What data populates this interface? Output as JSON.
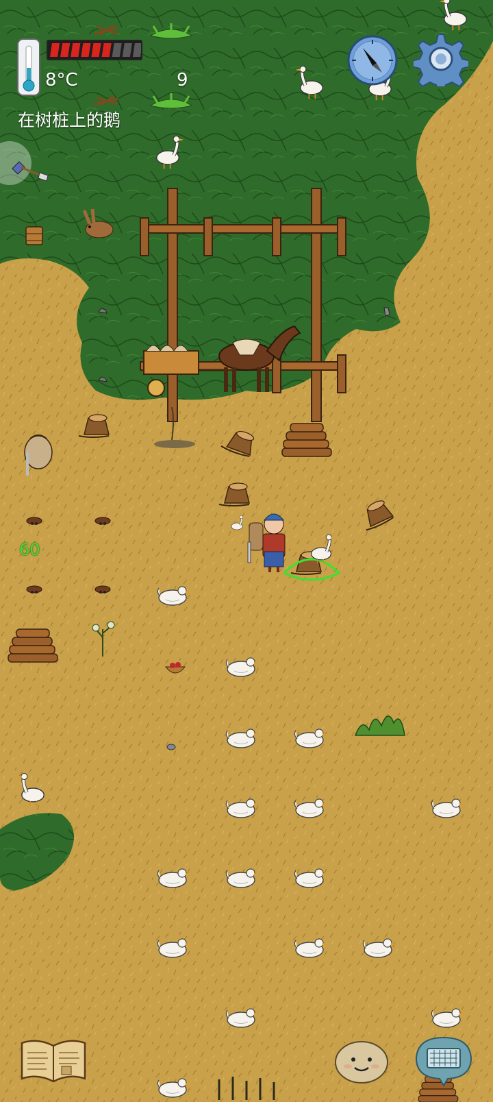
{
  "hud": {
    "temperature": "8°C",
    "food_count": "9",
    "hover_label": "在树桩上的鹅",
    "food_pips_filled": 6,
    "food_pips_total": 9
  },
  "age_number": "60",
  "colors": {
    "forest": "#2f6b2a",
    "grass": "#c9a14a",
    "food_pip_filled": "#d8261f",
    "food_pip_empty": "#5a5a5a",
    "age_text": "#3ee032"
  },
  "icons": {
    "thermometer": "thermometer-icon",
    "compass": "compass-icon",
    "settings": "gear-icon",
    "held_item": "shovel-icon",
    "book": "book-icon",
    "emote": "emote-face-icon",
    "keyboard": "keyboard-icon"
  }
}
